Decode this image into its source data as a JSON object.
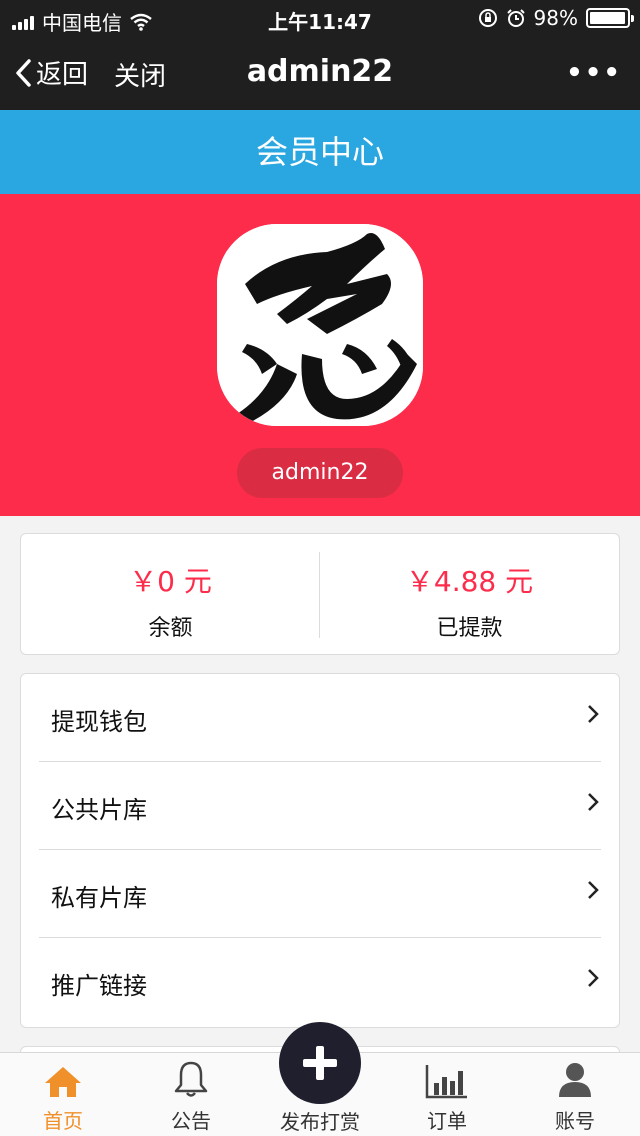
{
  "status_bar": {
    "carrier": "中国电信",
    "time": "上午11:47",
    "battery": "98%",
    "battery_level": 0.98
  },
  "nav": {
    "back_label": "返回",
    "close_label": "关闭",
    "title": "admin22",
    "more_label": "•••"
  },
  "header": {
    "title": "会员中心"
  },
  "profile": {
    "username": "admin22",
    "avatar_icon": "calligraphy-ren-icon"
  },
  "stats": [
    {
      "amount": "￥0 元",
      "label": "余额"
    },
    {
      "amount": "￥4.88 元",
      "label": "已提款"
    }
  ],
  "menu": [
    {
      "label": "提现钱包"
    },
    {
      "label": "公共片库"
    },
    {
      "label": "私有片库"
    },
    {
      "label": "推广链接"
    }
  ],
  "tabbar": {
    "items": [
      {
        "label": "首页",
        "icon": "home-icon",
        "active": true
      },
      {
        "label": "公告",
        "icon": "bell-icon",
        "active": false
      },
      {
        "label": "发布打赏",
        "icon": "plus-icon",
        "active": false
      },
      {
        "label": "订单",
        "icon": "bar-chart-icon",
        "active": false
      },
      {
        "label": "账号",
        "icon": "user-icon",
        "active": false
      }
    ]
  },
  "colors": {
    "nav_bg": "#1f1f1f",
    "header_bg": "#2aa7e0",
    "banner_bg": "#fd2c4b",
    "amount_color": "#fd2c4b",
    "active_tab": "#f0902a"
  }
}
